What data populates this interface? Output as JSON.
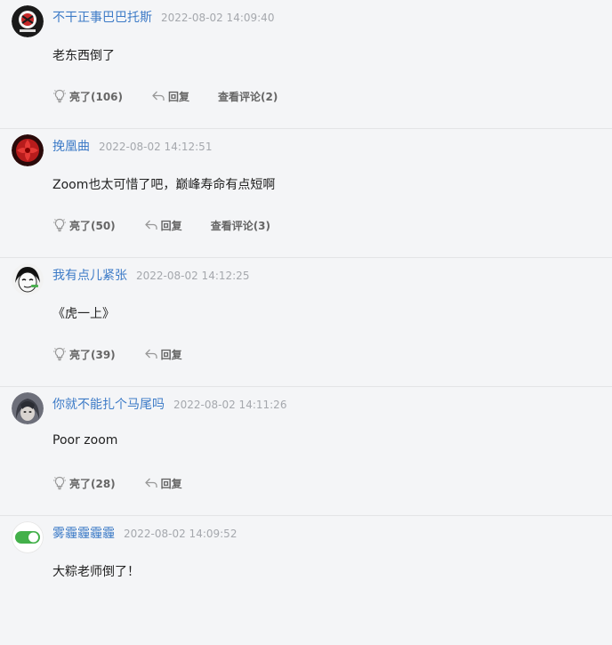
{
  "comments": [
    {
      "username": "不干正事巴巴托斯",
      "time": "2022-08-02 14:09:40",
      "content": "老东西倒了",
      "like_label": "亮了(106)",
      "reply_label": "回复",
      "view_label": "查看评论(2)",
      "avatar": "emblem-avatar"
    },
    {
      "username": "挽凰曲",
      "time": "2022-08-02 14:12:51",
      "content": "Zoom也太可惜了吧，巅峰寿命有点短啊",
      "like_label": "亮了(50)",
      "reply_label": "回复",
      "view_label": "查看评论(3)",
      "avatar": "red-flower-avatar"
    },
    {
      "username": "我有点儿紧张",
      "time": "2022-08-02 14:12:25",
      "content": "《虎一上》",
      "like_label": "亮了(39)",
      "reply_label": "回复",
      "avatar": "sketch-face-avatar"
    },
    {
      "username": "你就不能扎个马尾吗",
      "time": "2022-08-02 14:11:26",
      "content": "Poor zoom",
      "like_label": "亮了(28)",
      "reply_label": "回复",
      "avatar": "anime-girl-avatar"
    },
    {
      "username": "雾霾霾霾霾",
      "time": "2022-08-02 14:09:52",
      "content": "大粽老师倒了！",
      "avatar": "toggle-switch-avatar"
    }
  ],
  "colors": {
    "username": "#3d7bc7",
    "time": "#a5a8ad",
    "background": "#f4f5f7",
    "divider": "#e3e4e6"
  },
  "icons": {
    "like": "lightbulb-icon",
    "reply": "reply-arrow-icon"
  }
}
